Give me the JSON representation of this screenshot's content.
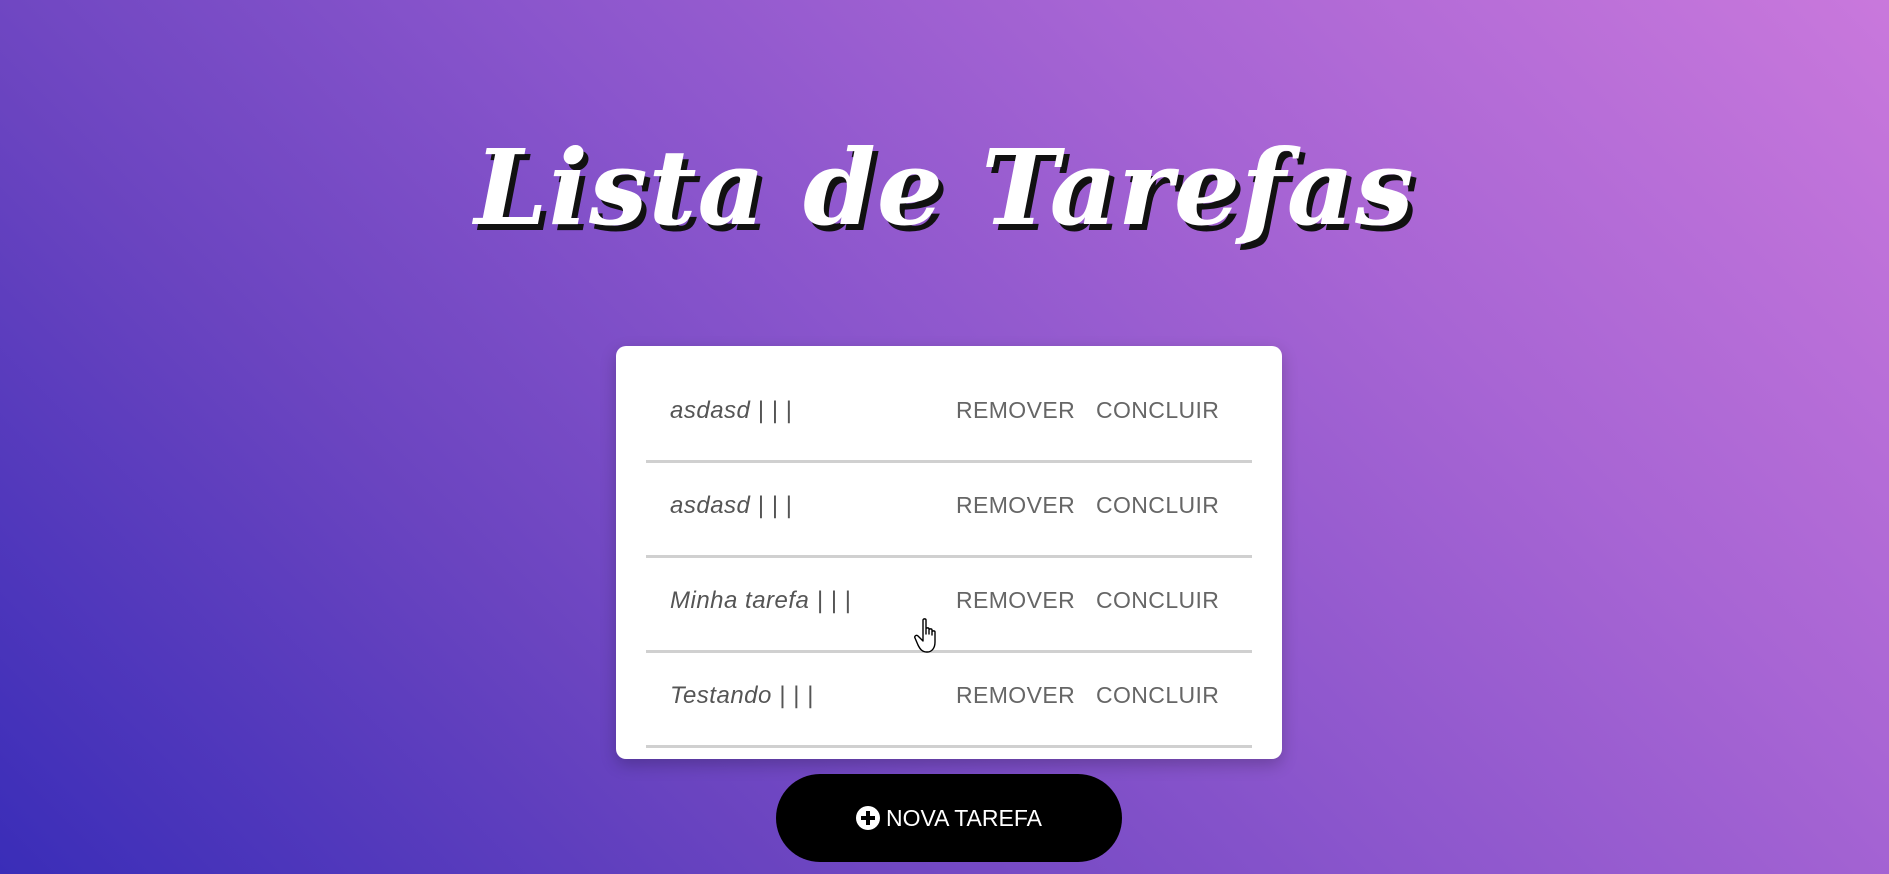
{
  "app": {
    "title": "Lista de Tarefas"
  },
  "tasks": [
    {
      "text": "asdasd | | |",
      "remove_label": "REMOVER",
      "done_label": "CONCLUIR"
    },
    {
      "text": "asdasd | | |",
      "remove_label": "REMOVER",
      "done_label": "CONCLUIR"
    },
    {
      "text": "Minha tarefa | | |",
      "remove_label": "REMOVER",
      "done_label": "CONCLUIR"
    },
    {
      "text": "Testando | | |",
      "remove_label": "REMOVER",
      "done_label": "CONCLUIR"
    }
  ],
  "new_task_button": {
    "label": "NOVA TAREFA",
    "icon": "plus-circle-icon"
  },
  "colors": {
    "gradient_start": "#3a2db8",
    "gradient_end": "#c978dc",
    "button_bg": "#000000",
    "card_bg": "#ffffff"
  }
}
